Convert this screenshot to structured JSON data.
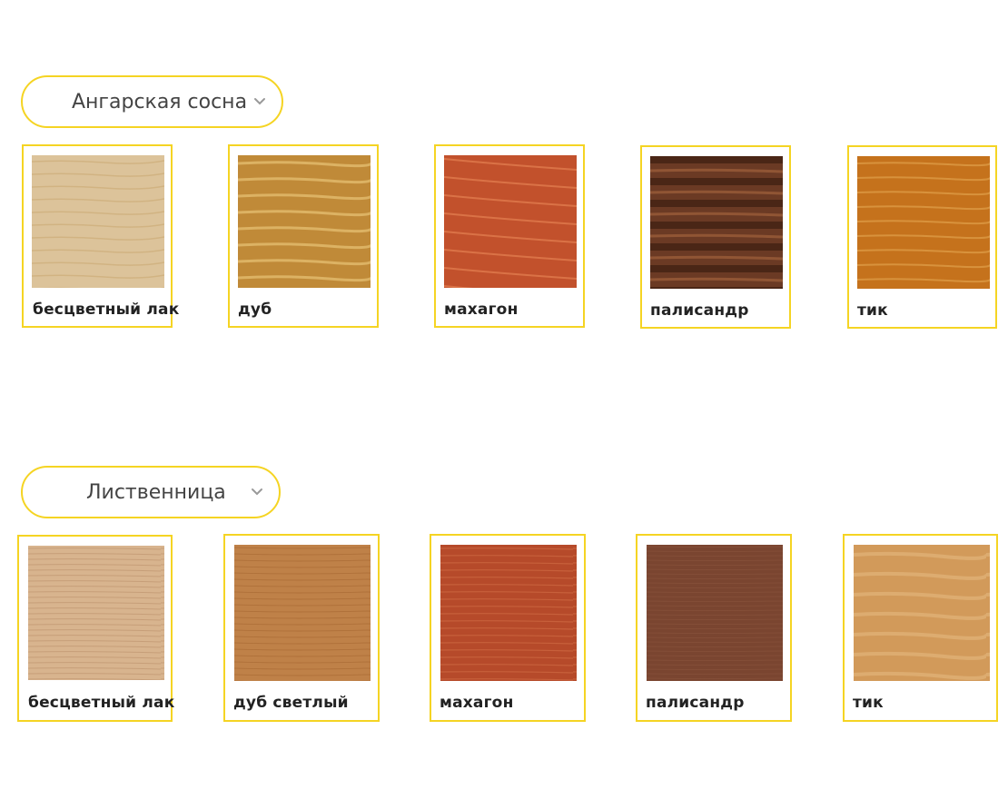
{
  "sections": [
    {
      "dropdown": {
        "label": "Ангарская сосна"
      },
      "cards": [
        {
          "label": "бесцветный лак",
          "color": "#dcc39a"
        },
        {
          "label": "дуб",
          "color": "#c9963f"
        },
        {
          "label": "махагон",
          "color": "#c2512c"
        },
        {
          "label": "палисандр",
          "color": "#6b3a24"
        },
        {
          "label": "тик",
          "color": "#c8761f"
        }
      ]
    },
    {
      "dropdown": {
        "label": "Лиственница"
      },
      "cards": [
        {
          "label": "бесцветный лак",
          "color": "#d8b48e"
        },
        {
          "label": "дуб светлый",
          "color": "#bf8148"
        },
        {
          "label": "махагон",
          "color": "#b64a2a"
        },
        {
          "label": "палисандр",
          "color": "#7a4530"
        },
        {
          "label": "тик",
          "color": "#d29a5a"
        }
      ]
    }
  ],
  "icons": {
    "dropdown_chevron": "chevron-down-icon"
  }
}
